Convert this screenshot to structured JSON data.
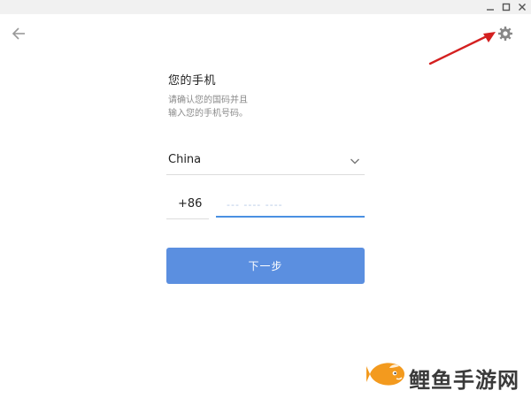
{
  "window": {
    "controls": {
      "minimize_icon": "minimize-icon",
      "maximize_icon": "maximize-icon",
      "close_icon": "close-icon"
    }
  },
  "nav": {
    "back_icon": "arrow-left-icon",
    "settings_icon": "gear-icon"
  },
  "header": {
    "title": "您的手机",
    "subtitle_line1": "请确认您的国码并且",
    "subtitle_line2": "输入您的手机号码。"
  },
  "form": {
    "country": "China",
    "country_code": "+86",
    "phone_placeholder": "--- ---- ----",
    "phone_value": "",
    "next_label": "下一步"
  },
  "watermark": {
    "text": "鲤鱼手游网"
  },
  "colors": {
    "accent": "#4a90e2",
    "button": "#5b8fe0",
    "annotation_arrow": "#d42020",
    "watermark_orange": "#f39a1e"
  }
}
